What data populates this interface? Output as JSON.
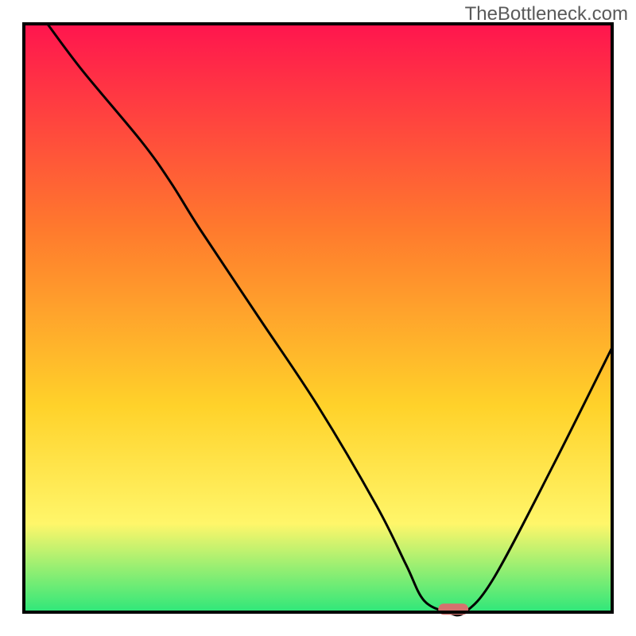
{
  "watermark": "TheBottleneck.com",
  "chart_data": {
    "type": "line",
    "title": "",
    "xlabel": "",
    "ylabel": "",
    "xlim": [
      0,
      100
    ],
    "ylim": [
      0,
      100
    ],
    "series": [
      {
        "name": "curve",
        "x": [
          4,
          10,
          20,
          25,
          30,
          40,
          50,
          60,
          65,
          68,
          72,
          75,
          80,
          90,
          100
        ],
        "values": [
          100,
          92,
          80,
          73,
          65,
          50,
          35,
          18,
          8,
          2,
          0,
          0,
          6,
          25,
          45
        ]
      }
    ],
    "marker": {
      "x": 73,
      "y": 0.5
    },
    "gradient": {
      "top": "#ff154e",
      "mid1": "#ff7a2d",
      "mid2": "#ffd22a",
      "mid3": "#fff66a",
      "bottom": "#2ee77a"
    },
    "frame_color": "#000000",
    "curve_color": "#000000",
    "marker_color": "#d5726e"
  }
}
